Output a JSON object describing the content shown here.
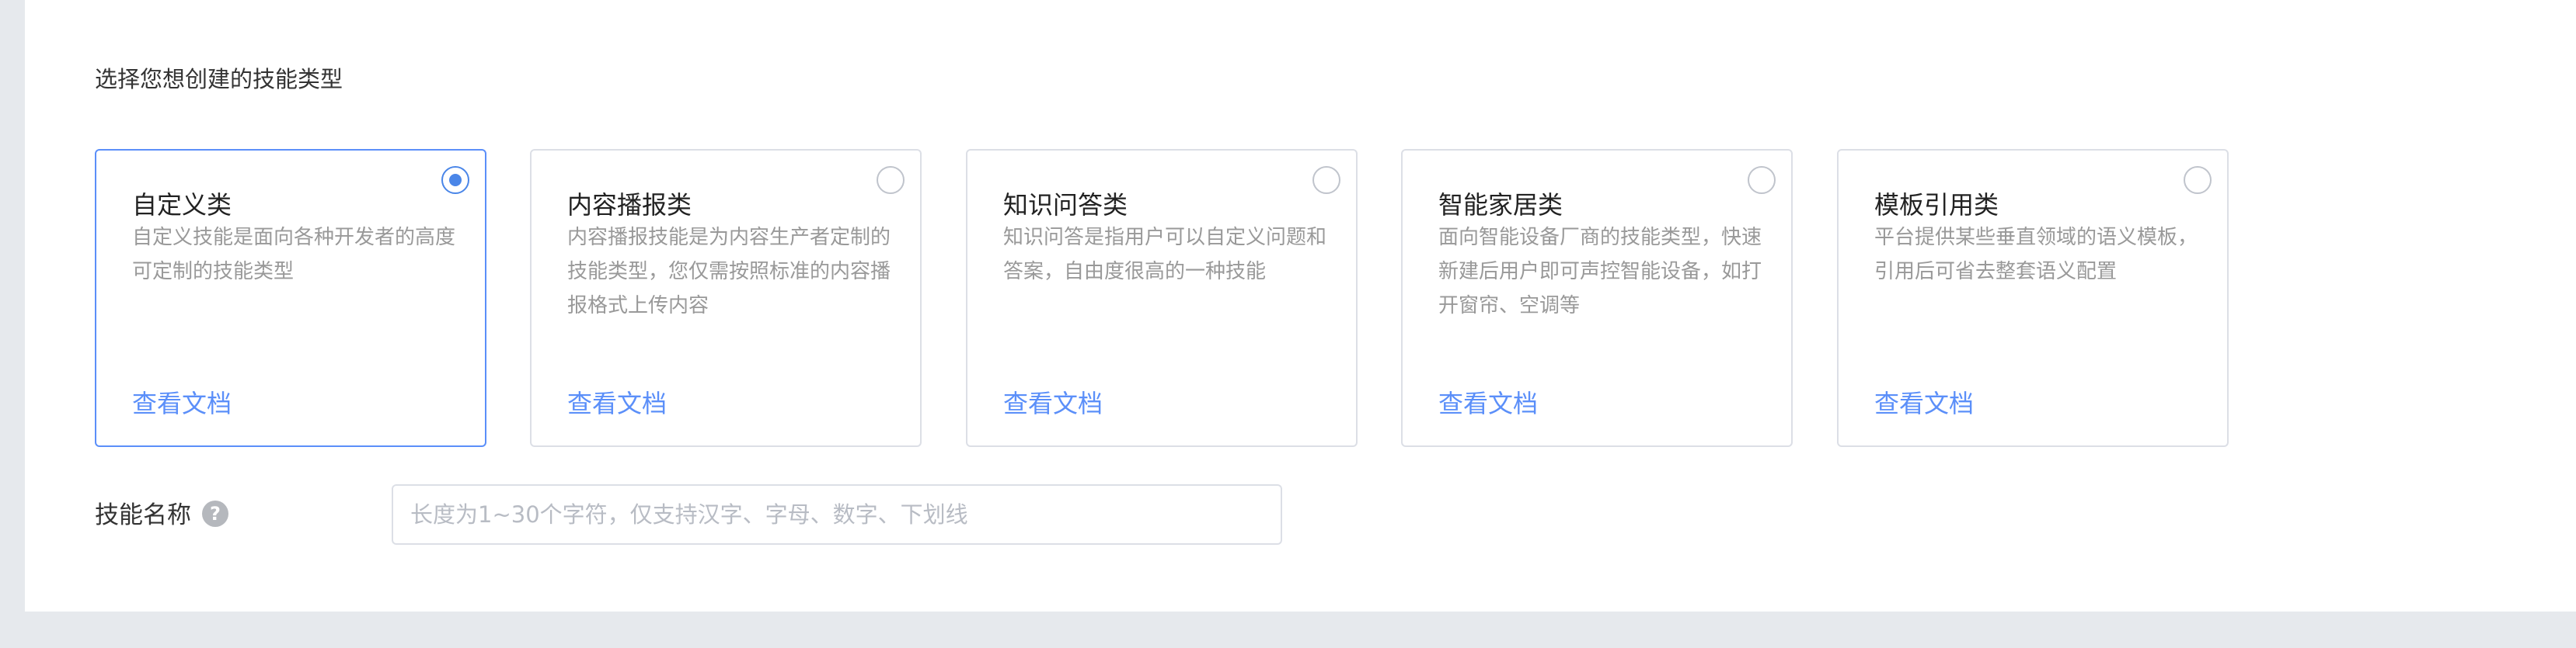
{
  "section_title": "选择您想创建的技能类型",
  "skill_types": [
    {
      "title": "自定义类",
      "description": "自定义技能是面向各种开发者的高度可定制的技能类型",
      "link": "查看文档",
      "selected": true
    },
    {
      "title": "内容播报类",
      "description": "内容播报技能是为内容生产者定制的技能类型，您仅需按照标准的内容播报格式上传内容",
      "link": "查看文档",
      "selected": false
    },
    {
      "title": "知识问答类",
      "description": "知识问答是指用户可以自定义问题和答案，自由度很高的一种技能",
      "link": "查看文档",
      "selected": false
    },
    {
      "title": "智能家居类",
      "description": "面向智能设备厂商的技能类型，快速新建后用户即可声控智能设备，如打开窗帘、空调等",
      "link": "查看文档",
      "selected": false
    },
    {
      "title": "模板引用类",
      "description": "平台提供某些垂直领域的语义模板，引用后可省去整套语义配置",
      "link": "查看文档",
      "selected": false
    }
  ],
  "skill_name": {
    "label": "技能名称",
    "help_icon": "question-circle-icon",
    "value": "",
    "placeholder": "长度为1~30个字符，仅支持汉字、字母、数字、下划线"
  },
  "colors": {
    "accent": "#4a86e8",
    "link": "#5b8ff9",
    "border": "#dcdfe6",
    "page_background": "#e6e9ed"
  }
}
